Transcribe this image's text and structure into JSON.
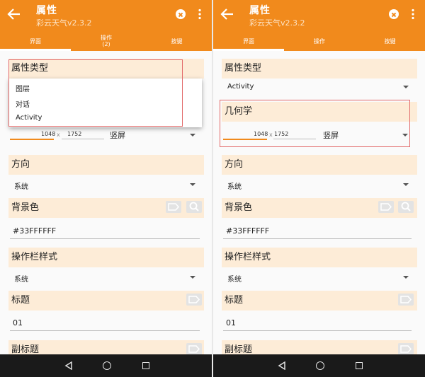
{
  "colors": {
    "primary": "#f18a1c",
    "section_bg": "#fdecd7",
    "highlight_box": "#e26a6a",
    "nav_bar": "#1a1a1a"
  },
  "left": {
    "appbar": {
      "title": "属性",
      "subtitle": "彩云天气v2.3.2"
    },
    "tabs": [
      {
        "label": "界面",
        "active": true
      },
      {
        "label": "操作",
        "sub": "(2)"
      },
      {
        "label": "按键"
      }
    ],
    "sections": {
      "attr_type": {
        "header": "属性类型"
      },
      "popup_items": [
        "图层",
        "对话",
        "Activity"
      ],
      "geometry": {
        "width": "1048",
        "x": "x",
        "height": "1752",
        "orientation": "竖屏"
      },
      "direction": {
        "header": "方向",
        "value": "系统"
      },
      "bg_color": {
        "header": "背景色",
        "value": "#33FFFFFF"
      },
      "actionbar": {
        "header": "操作栏样式",
        "value": "系统"
      },
      "title": {
        "header": "标题",
        "value": "01"
      },
      "subtitle": {
        "header": "副标题"
      }
    }
  },
  "right": {
    "appbar": {
      "title": "属性",
      "subtitle": "彩云天气v2.3.2"
    },
    "tabs": [
      {
        "label": "界面",
        "active": true
      },
      {
        "label": "操作"
      },
      {
        "label": "按键"
      }
    ],
    "sections": {
      "attr_type": {
        "header": "属性类型",
        "value": "Activity"
      },
      "geometry": {
        "header": "几何学",
        "width": "1048",
        "x": "x",
        "height": "1752",
        "orientation": "竖屏"
      },
      "direction": {
        "header": "方向",
        "value": "系统"
      },
      "bg_color": {
        "header": "背景色",
        "value": "#33FFFFFF"
      },
      "actionbar": {
        "header": "操作栏样式",
        "value": "系统"
      },
      "title": {
        "header": "标题",
        "value": "01"
      },
      "subtitle": {
        "header": "副标题"
      }
    }
  }
}
